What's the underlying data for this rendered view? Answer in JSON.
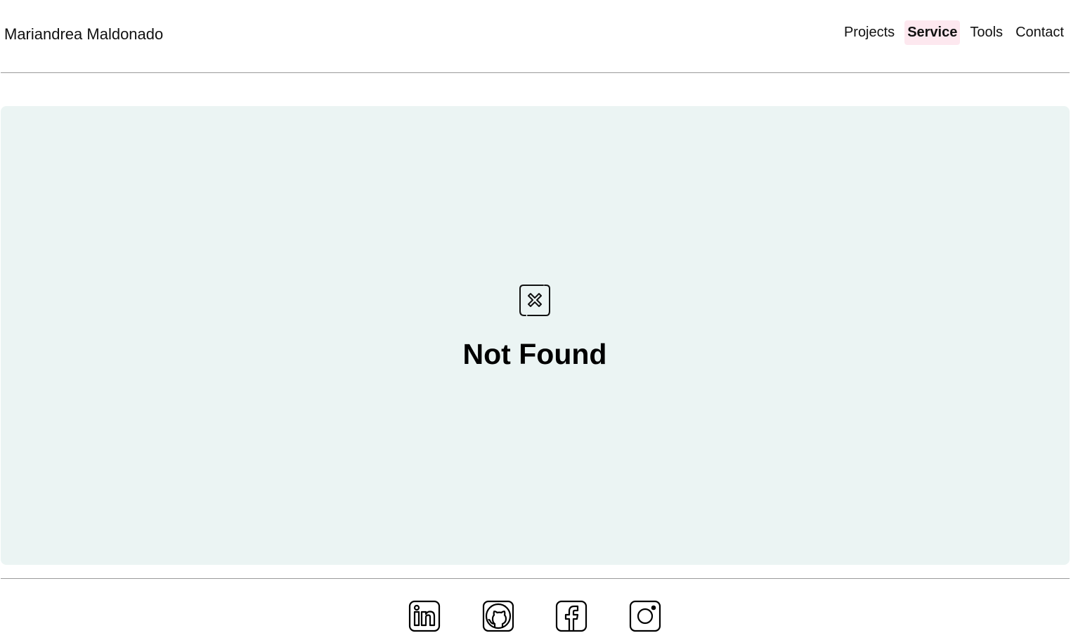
{
  "header": {
    "brand": "Mariandrea Maldonado",
    "nav": [
      {
        "label": "Projects",
        "active": false
      },
      {
        "label": "Service",
        "active": true
      },
      {
        "label": "Tools",
        "active": false
      },
      {
        "label": "Contact",
        "active": false
      }
    ]
  },
  "main": {
    "icon": "broken-image-icon",
    "title": "Not Found"
  },
  "footer": {
    "social": [
      {
        "icon": "linkedin-icon"
      },
      {
        "icon": "github-icon"
      },
      {
        "icon": "facebook-icon"
      },
      {
        "icon": "instagram-icon"
      }
    ]
  },
  "colors": {
    "card_background": "#ebf4f3",
    "active_nav_background": "#fde8ef",
    "divider": "#9a9a9a"
  }
}
